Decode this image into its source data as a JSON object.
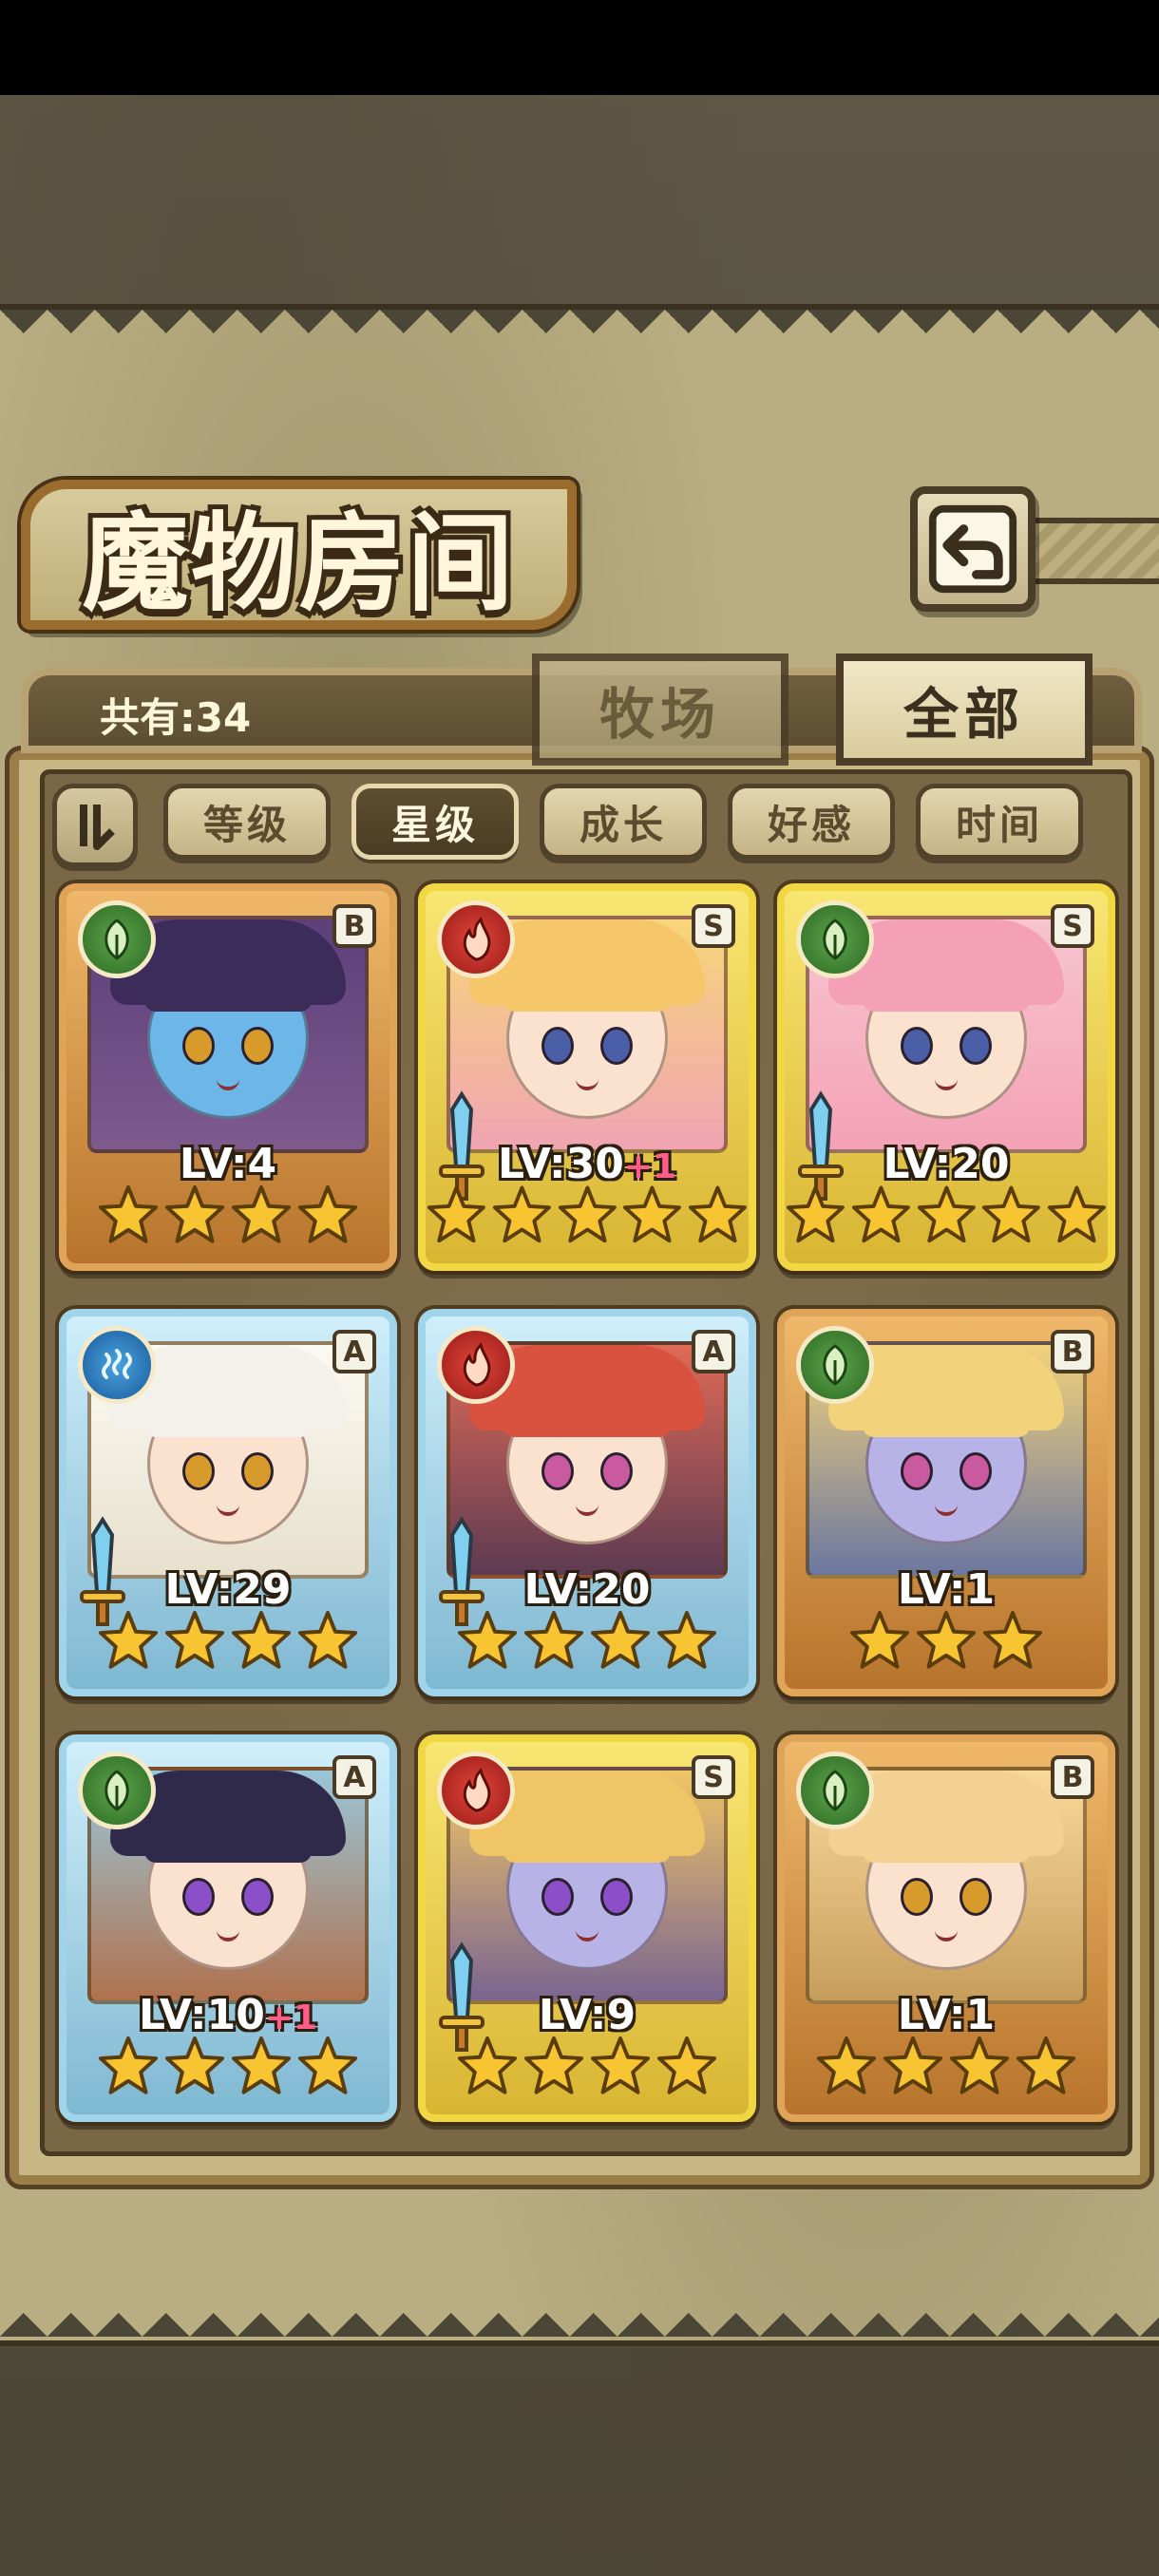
{
  "title": "魔物房间",
  "count_label": "共有:34",
  "top_tabs": [
    {
      "label": "牧场",
      "active": false
    },
    {
      "label": "全部",
      "active": true
    }
  ],
  "sort_buttons": [
    {
      "label": "等级",
      "active": false
    },
    {
      "label": "星级",
      "active": true
    },
    {
      "label": "成长",
      "active": false
    },
    {
      "label": "好感",
      "active": false
    },
    {
      "label": "时间",
      "active": false
    }
  ],
  "cards": [
    {
      "lv": "LV:4",
      "plus": "",
      "rank": "B",
      "element": "nature-icon",
      "stars": 4,
      "frame": "bronze",
      "sword": false
    },
    {
      "lv": "LV:30",
      "plus": "+1",
      "rank": "S",
      "element": "fire-icon",
      "stars": 5,
      "frame": "gold",
      "sword": true
    },
    {
      "lv": "LV:20",
      "plus": "",
      "rank": "S",
      "element": "nature-icon",
      "stars": 5,
      "frame": "gold",
      "sword": true
    },
    {
      "lv": "LV:29",
      "plus": "",
      "rank": "A",
      "element": "water-icon",
      "stars": 4,
      "frame": "ice",
      "sword": true
    },
    {
      "lv": "LV:20",
      "plus": "",
      "rank": "A",
      "element": "fire-icon",
      "stars": 4,
      "frame": "ice",
      "sword": true
    },
    {
      "lv": "LV:1",
      "plus": "",
      "rank": "B",
      "element": "nature-icon",
      "stars": 3,
      "frame": "bronze",
      "sword": false
    },
    {
      "lv": "LV:10",
      "plus": "+1",
      "rank": "A",
      "element": "nature-icon",
      "stars": 4,
      "frame": "ice",
      "sword": false
    },
    {
      "lv": "LV:9",
      "plus": "",
      "rank": "S",
      "element": "fire-icon",
      "stars": 4,
      "frame": "gold",
      "sword": true
    },
    {
      "lv": "LV:1",
      "plus": "",
      "rank": "B",
      "element": "nature-icon",
      "stars": 4,
      "frame": "bronze",
      "sword": false
    }
  ],
  "colors": {
    "star": "#f7c531",
    "gold_frame": "#f2d744",
    "bronze_frame": "#e0a458",
    "ice_frame": "#9fd4ea"
  }
}
